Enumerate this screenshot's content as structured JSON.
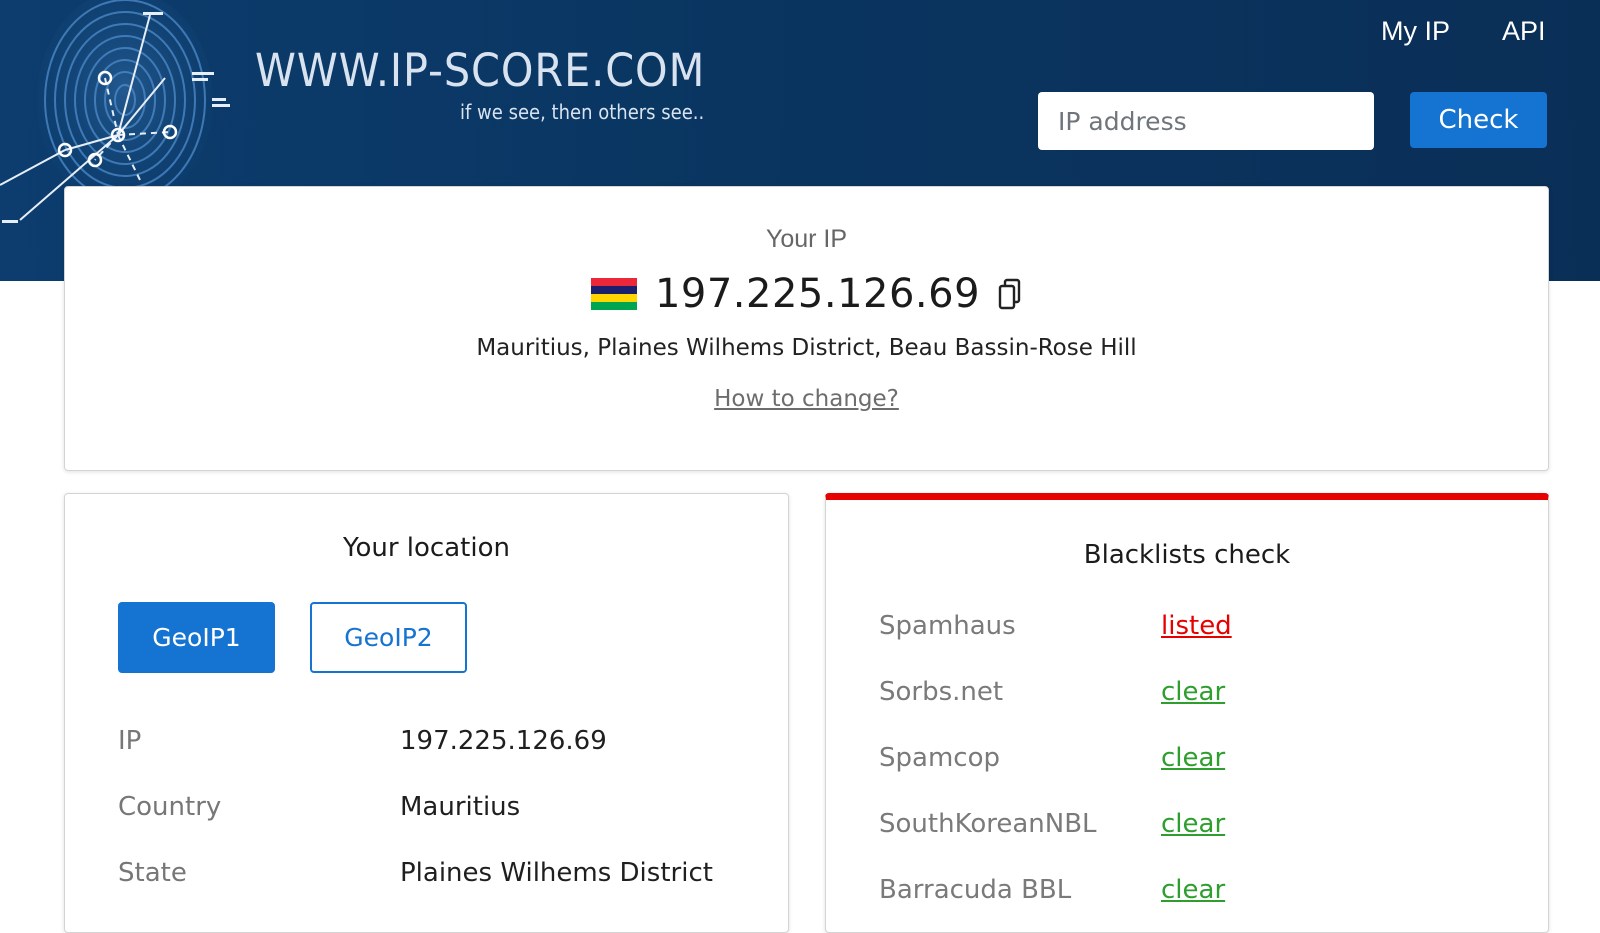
{
  "header": {
    "site_title": "WWW.IP-SCORE.COM",
    "tagline": "if we see, then others see..",
    "nav": {
      "my_ip": "My IP",
      "api": "API"
    },
    "search": {
      "placeholder": "IP address",
      "button_label": "Check"
    },
    "logo_icon": "fingerprint-icon"
  },
  "ip_card": {
    "label": "Your IP",
    "ip": "197.225.126.69",
    "flag_colors": [
      "#EA2839",
      "#1A206D",
      "#FFD500",
      "#00A551"
    ],
    "location_text": "Mauritius, Plaines Wilhems District, Beau Bassin-Rose Hill",
    "how_to_change": "How to change?",
    "copy_icon": "copy-icon"
  },
  "location_card": {
    "title": "Your location",
    "tabs": [
      {
        "label": "GeoIP1",
        "active": true
      },
      {
        "label": "GeoIP2",
        "active": false
      }
    ],
    "rows": [
      {
        "key": "IP",
        "value": "197.225.126.69"
      },
      {
        "key": "Country",
        "value": "Mauritius"
      },
      {
        "key": "State",
        "value": "Plaines Wilhems District"
      }
    ]
  },
  "blacklist_card": {
    "title": "Blacklists check",
    "accent_color": "#E60000",
    "items": [
      {
        "name": "Spamhaus",
        "status": "listed"
      },
      {
        "name": "Sorbs.net",
        "status": "clear"
      },
      {
        "name": "Spamcop",
        "status": "clear"
      },
      {
        "name": "SouthKoreanNBL",
        "status": "clear"
      },
      {
        "name": "Barracuda BBL",
        "status": "clear"
      }
    ]
  },
  "colors": {
    "header_bg": "#0B3862",
    "primary_blue": "#1573D2",
    "listed_red": "#E60000",
    "clear_green": "#2E9F2E"
  }
}
